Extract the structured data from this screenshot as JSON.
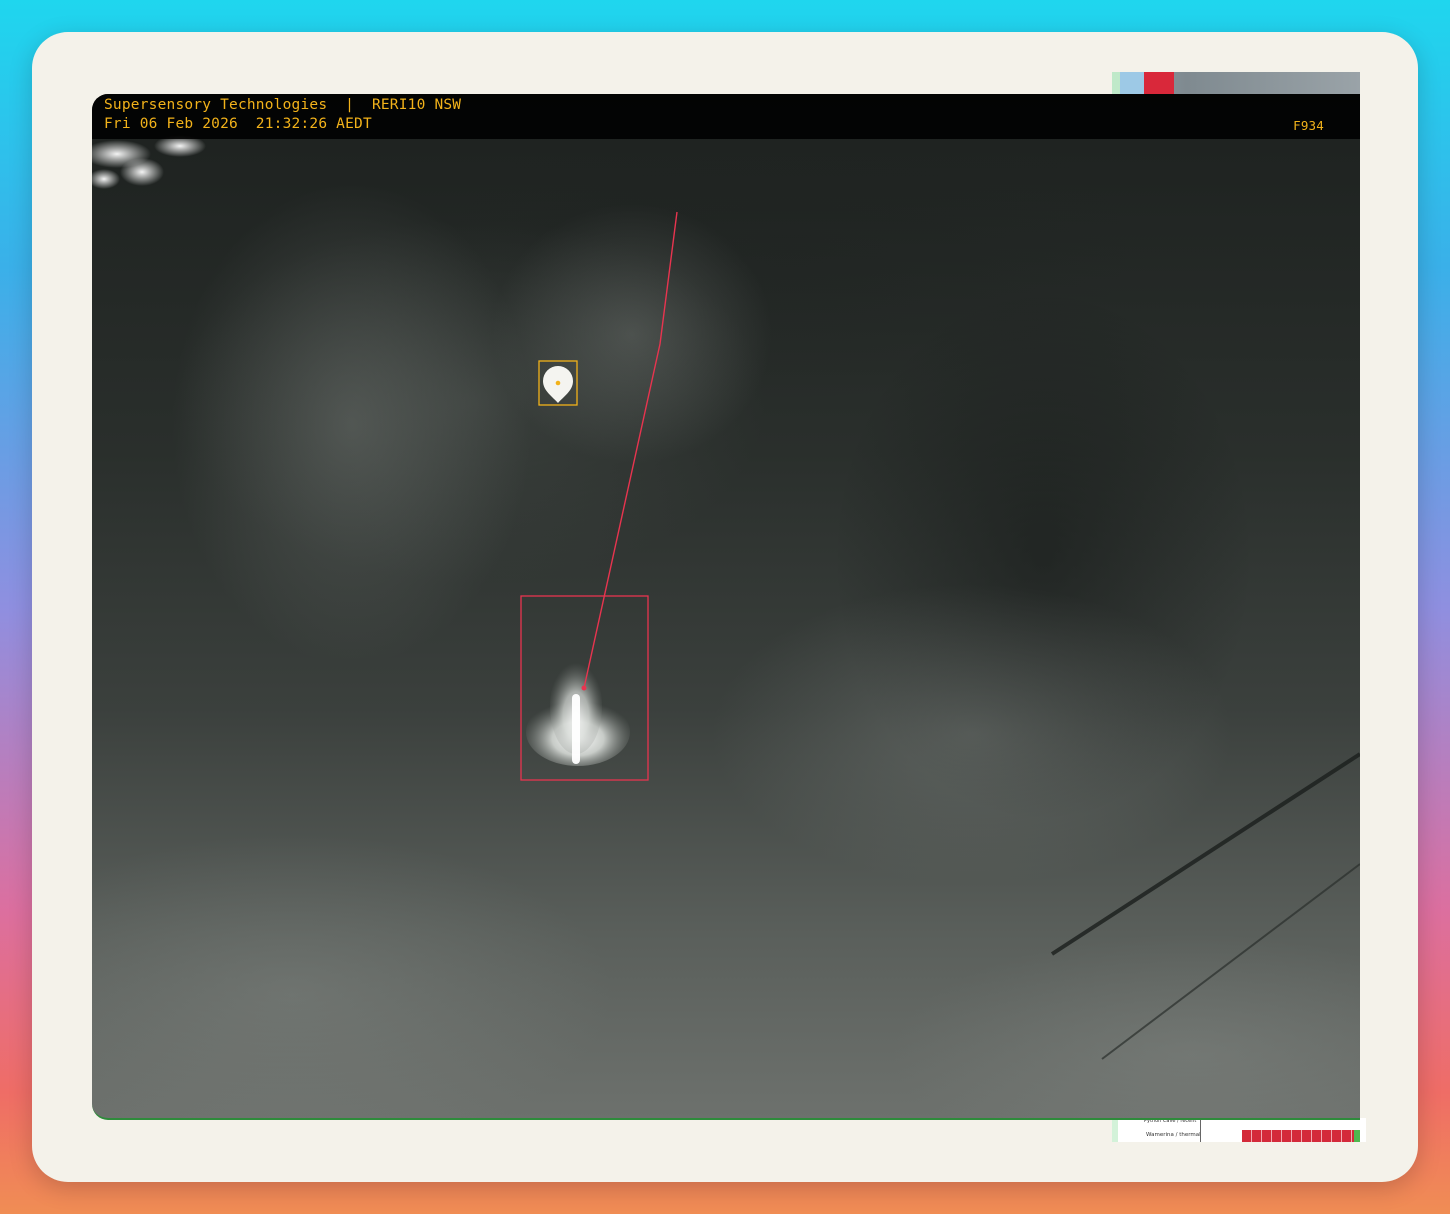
{
  "overlay": {
    "company": "Supersensory Technologies",
    "separator": "|",
    "station": "RERI10 NSW",
    "datetime": "Fri 06 Feb 2026  21:32:26 AEDT",
    "frame": "F934"
  },
  "background_window": {
    "row_labels": [
      "Python Cave / recent",
      "Wamerina / thermal"
    ]
  },
  "colors": {
    "overlay_text": "#f2b21a",
    "target_box": "#e8344f",
    "marker_box": "#f2b21a",
    "trajectory": "#e8344f"
  },
  "icons": {
    "marker": "location-pin-icon"
  }
}
